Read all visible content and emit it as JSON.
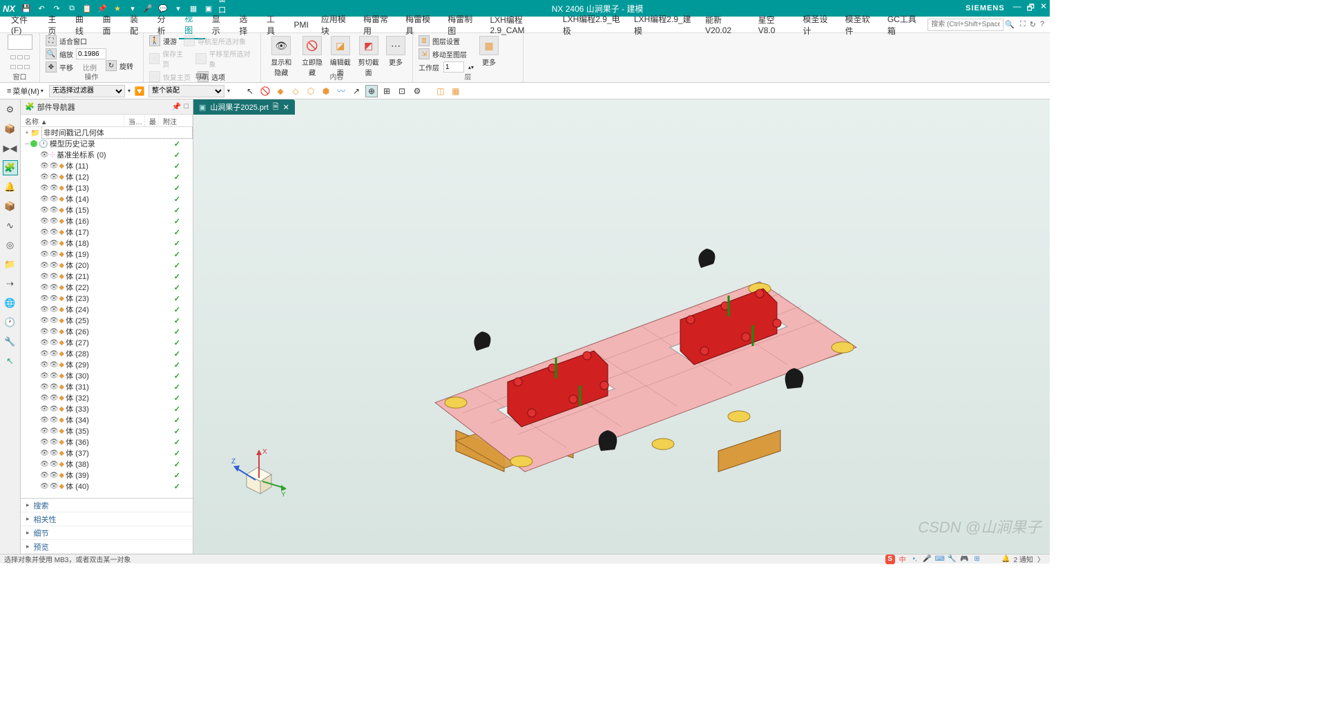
{
  "app": {
    "logo": "NX",
    "title": "NX 2406 山涧果子 - 建模",
    "brand": "SIEMENS"
  },
  "qat_icons": [
    "save",
    "undo",
    "redo",
    "copy",
    "paste",
    "pin",
    "star",
    "mic",
    "chat",
    "grid",
    "box",
    "window"
  ],
  "qat_window_label": "窗口▾",
  "menu": {
    "items": [
      "文件(F)",
      "主页",
      "曲线",
      "曲面",
      "装配",
      "分析",
      "视图",
      "显示",
      "选择",
      "工具",
      "PMI",
      "应用模块",
      "梅雷常用",
      "梅雷模具",
      "梅雷制图",
      "LXH编程2.9_CAM",
      "LXH编程2.9_电极",
      "LXH编程2.9_建模",
      "能新 V20.02",
      "星空 V8.0",
      "模圣设计",
      "模圣软件",
      "GC工具箱"
    ],
    "active_index": 6,
    "search_placeholder": "搜索 (Ctrl+Shift+Space)"
  },
  "ribbon": {
    "groups": {
      "window": {
        "label": "窗口",
        "btn": "▾"
      },
      "operate": {
        "label": "操作",
        "fit_window": "适合窗口",
        "zoom": "缩放",
        "zoom_value": "0.1986",
        "scale": "比例",
        "pan": "平移",
        "rotate": "旋转"
      },
      "nav": {
        "label": "导航",
        "stroll": "漫游",
        "nav_to_sel": "导航至所选对象",
        "save_home": "保存主页",
        "pan_to_sel": "平移至所选对象",
        "restore_home": "恢复主页",
        "options": "选项"
      },
      "content": {
        "label": "内容",
        "show_hide": "显示和隐藏",
        "hide_now": "立即隐藏",
        "edit_section": "编辑截面",
        "clip_section": "剪切截面",
        "more": "更多"
      },
      "layer": {
        "label": "层",
        "layer_settings": "图层设置",
        "move_to_layer": "移动至图层",
        "work_layer": "工作层",
        "work_layer_value": "1",
        "more": "更多"
      }
    }
  },
  "selbar": {
    "menu": "菜单(M)",
    "filter1": "无选择过滤器",
    "filter2": "整个装配"
  },
  "nav": {
    "title": "部件导航器",
    "columns": [
      "名称 ▲",
      "当…",
      "最",
      "附注"
    ],
    "root1": "非时间戳记几何体",
    "root2": "模型历史记录",
    "coord": "基准坐标系 (0)",
    "bodies": [
      "体 (11)",
      "体 (12)",
      "体 (13)",
      "体 (14)",
      "体 (15)",
      "体 (16)",
      "体 (17)",
      "体 (18)",
      "体 (19)",
      "体 (20)",
      "体 (21)",
      "体 (22)",
      "体 (23)",
      "体 (24)",
      "体 (25)",
      "体 (26)",
      "体 (27)",
      "体 (28)",
      "体 (29)",
      "体 (30)",
      "体 (31)",
      "体 (32)",
      "体 (33)",
      "体 (34)",
      "体 (35)",
      "体 (36)",
      "体 (37)",
      "体 (38)",
      "体 (39)",
      "体 (40)"
    ],
    "accordion": [
      "搜索",
      "相关性",
      "细节",
      "预览"
    ]
  },
  "filetab": {
    "name": "山涧果子2025.prt",
    "dirty": "🗎"
  },
  "triad": {
    "x": "X",
    "y": "Y",
    "z": "Z"
  },
  "status": {
    "hint": "选择对象并使用 MB3，或者双击某一对象",
    "notify": "2 通知"
  },
  "watermark": "CSDN @山涧果子"
}
